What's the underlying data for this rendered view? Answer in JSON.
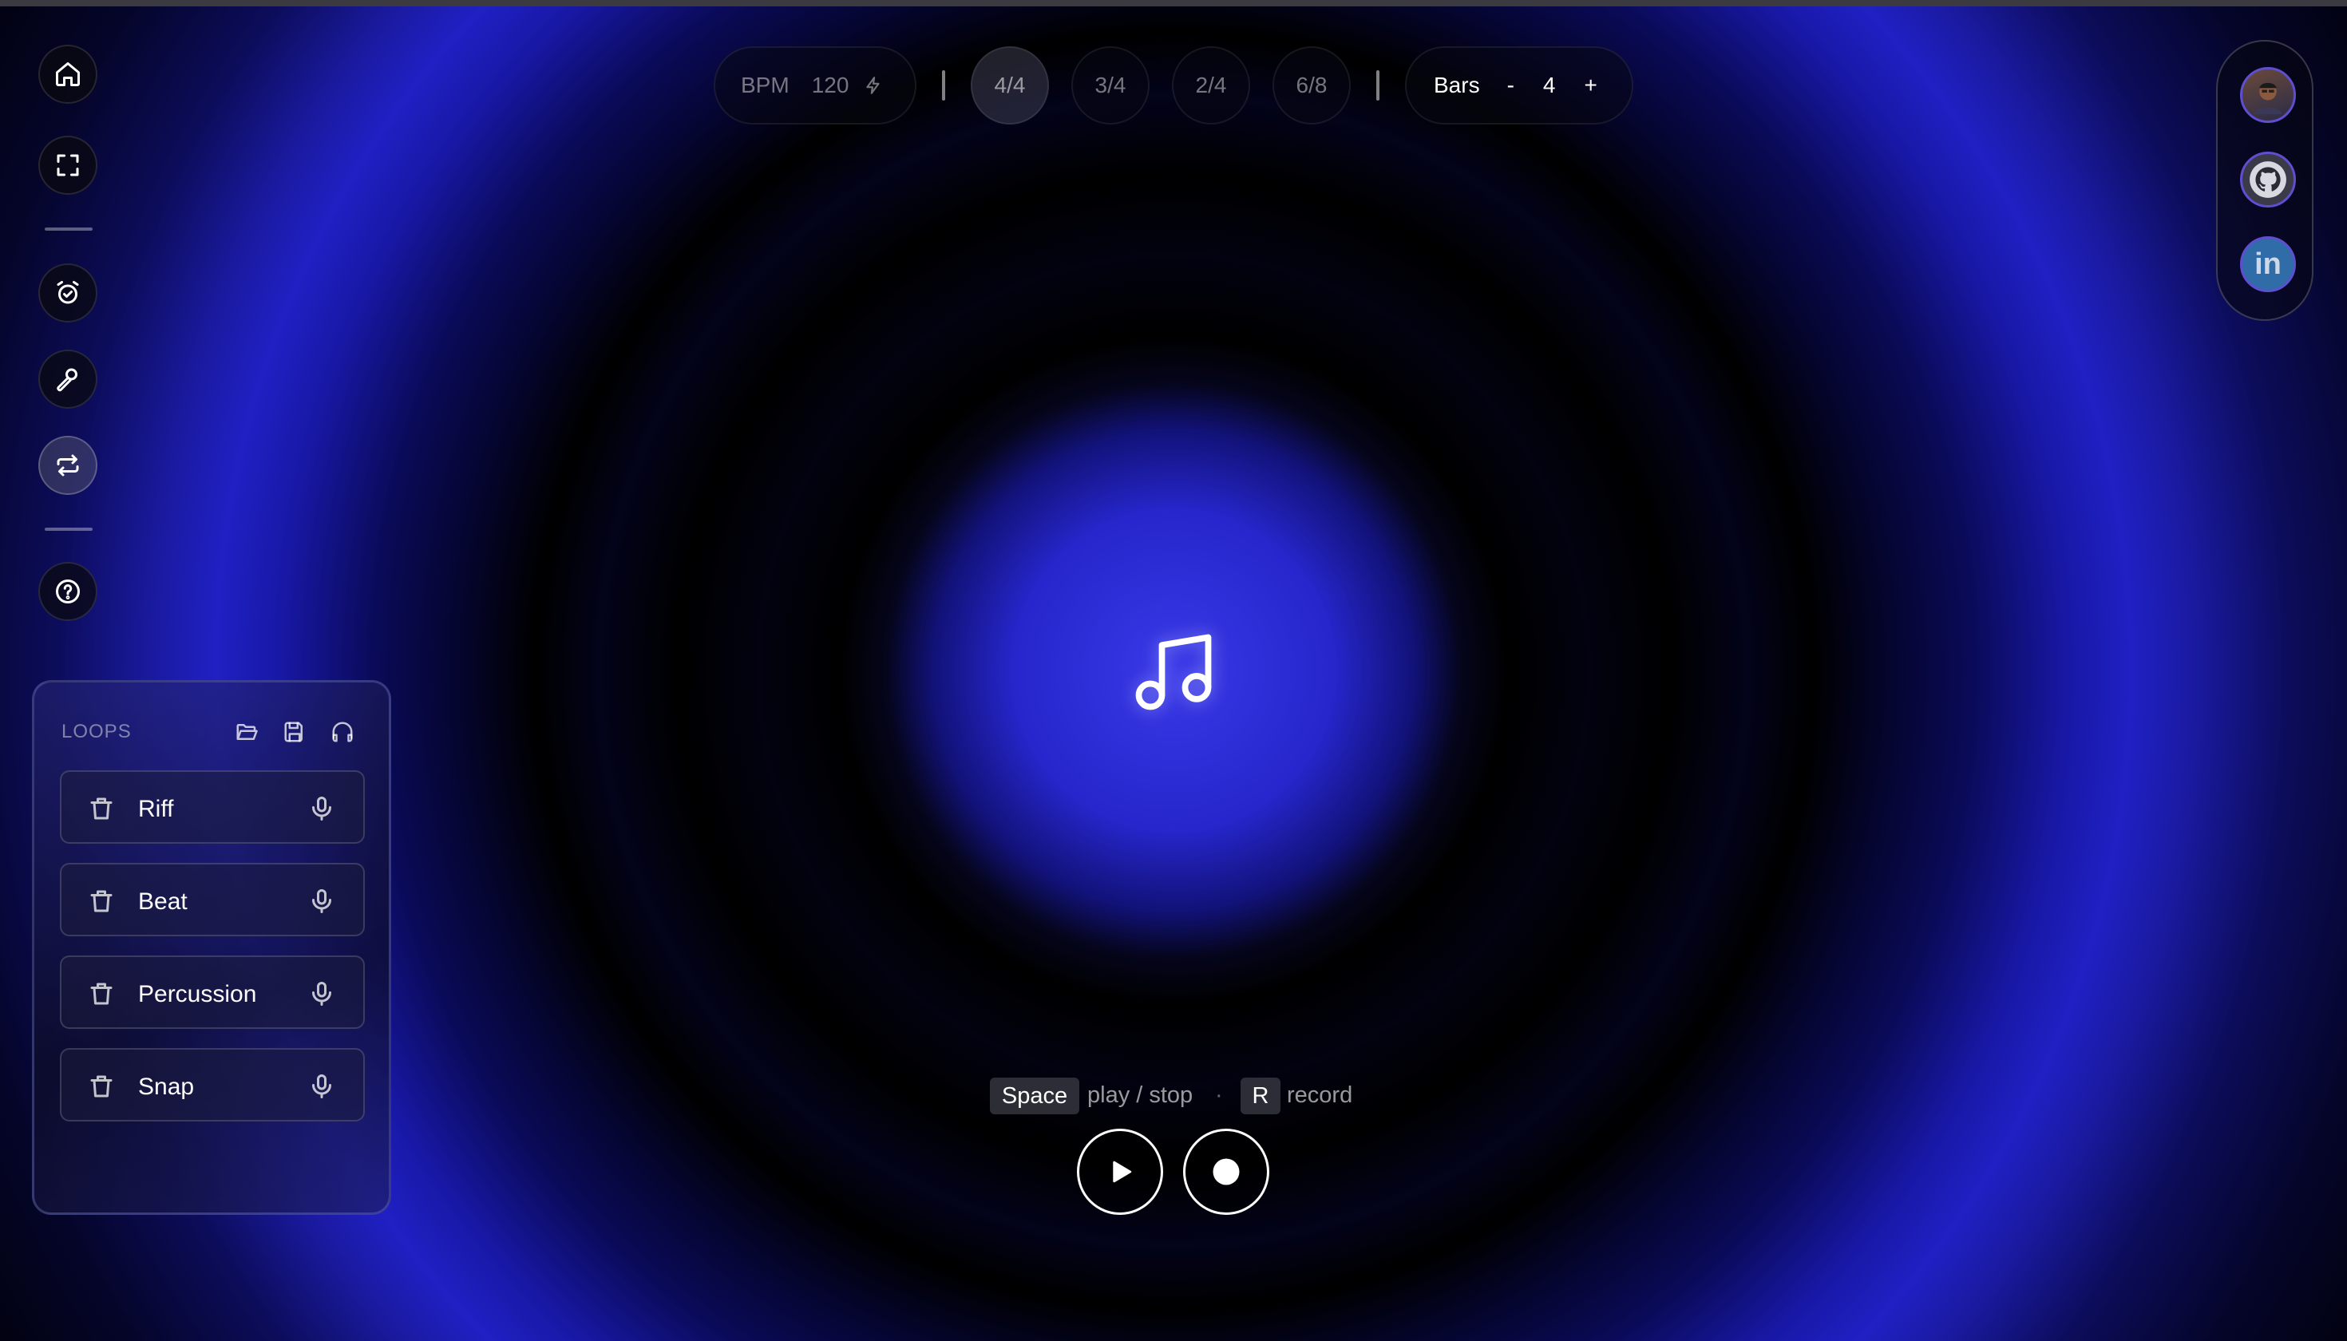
{
  "toolbar": {
    "bpm_label": "BPM",
    "bpm_value": "120",
    "signatures": [
      "4/4",
      "3/4",
      "2/4",
      "6/8"
    ],
    "active_signature": "4/4",
    "bars_label": "Bars",
    "bars_minus": "-",
    "bars_value": "4",
    "bars_plus": "+"
  },
  "left_rail": {
    "items": [
      "home-icon",
      "fullscreen-icon",
      "alarm-icon",
      "brush-icon",
      "loop-icon",
      "help-icon"
    ],
    "active": "loop-icon"
  },
  "social": {
    "items": [
      "avatar",
      "github-icon",
      "linkedin-icon"
    ],
    "linkedin_text": "in"
  },
  "loops": {
    "title": "LOOPS",
    "tools": [
      "folder-open-icon",
      "save-icon",
      "headphones-icon"
    ],
    "items": [
      {
        "name": "Riff"
      },
      {
        "name": "Beat"
      },
      {
        "name": "Percussion"
      },
      {
        "name": "Snap"
      }
    ]
  },
  "shortcuts": {
    "space_key": "Space",
    "space_action": "play / stop",
    "separator": "·",
    "r_key": "R",
    "r_action": "record"
  },
  "colors": {
    "background": "#000000",
    "glow": "#2626cc",
    "accent_ring": "#5f4ed0"
  }
}
